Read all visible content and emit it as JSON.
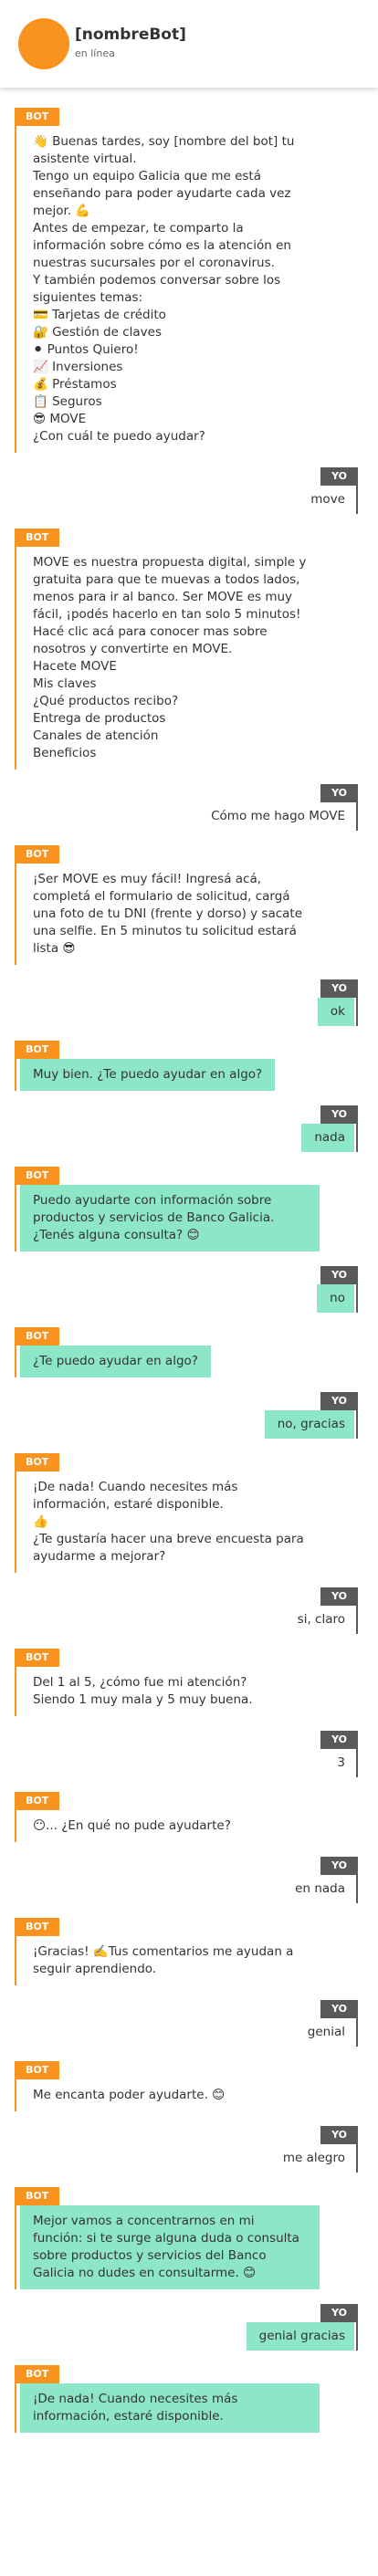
{
  "header": {
    "name": "[nombreBot]",
    "status": "en línea"
  },
  "colors": {
    "bot_accent": "#f7931e",
    "user_accent": "#5a5a5a",
    "highlight": "#8de6c7"
  },
  "labels": {
    "bot": "BOT",
    "user": "YO"
  },
  "messages": [
    {
      "from": "bot",
      "hl": false,
      "text": "👋 Buenas tardes, soy [nombre del bot] tu asistente virtual.\nTengo un equipo Galicia que me está enseñando para poder ayudarte cada vez mejor. 💪\nAntes de empezar, te comparto la información sobre cómo es la atención en nuestras sucursales por el coronavirus.\nY también podemos conversar sobre los siguientes temas:\n💳 Tarjetas de crédito\n🔐 Gestión de claves\n⚫ Puntos Quiero!\n📈 Inversiones\n💰 Préstamos\n📋 Seguros\n😎 MOVE\n¿Con cuál te puedo ayudar?"
    },
    {
      "from": "user",
      "hl": false,
      "text": "move"
    },
    {
      "from": "bot",
      "hl": false,
      "text": "MOVE es nuestra propuesta digital, simple y gratuita para que te muevas a todos lados, menos para ir al banco. Ser MOVE es muy fácil, ¡podés hacerlo en tan solo 5 minutos!\nHacé clic acá para conocer mas sobre nosotros y convertirte en MOVE.\nHacete MOVE\nMis claves\n¿Qué productos recibo?\nEntrega de productos\nCanales de atención\nBeneficios"
    },
    {
      "from": "user",
      "hl": false,
      "text": "Cómo me hago MOVE"
    },
    {
      "from": "bot",
      "hl": false,
      "text": "¡Ser MOVE es muy fácil! Ingresá acá, completá el formulario de solicitud, cargá una foto de tu DNI (frente y dorso) y sacate una selfie. En 5 minutos tu solicitud estará lista 😎"
    },
    {
      "from": "user",
      "hl": true,
      "text": "ok"
    },
    {
      "from": "bot",
      "hl": true,
      "text": "Muy bien. ¿Te puedo ayudar en algo?"
    },
    {
      "from": "user",
      "hl": true,
      "text": "nada"
    },
    {
      "from": "bot",
      "hl": true,
      "text": "Puedo ayudarte con información sobre productos y servicios de Banco Galicia. ¿Tenés alguna consulta? 😊"
    },
    {
      "from": "user",
      "hl": true,
      "text": "no"
    },
    {
      "from": "bot",
      "hl": true,
      "text": "¿Te puedo ayudar en algo?"
    },
    {
      "from": "user",
      "hl": true,
      "text": "no, gracias"
    },
    {
      "from": "bot",
      "hl": false,
      "text": "¡De nada! Cuando necesites más información, estaré disponible.\n👍\n¿Te gustaría hacer una breve encuesta para ayudarme a mejorar?"
    },
    {
      "from": "user",
      "hl": false,
      "text": "si, claro"
    },
    {
      "from": "bot",
      "hl": false,
      "text": "Del 1 al 5, ¿cómo fue mi atención?\nSiendo 1 muy mala y 5 muy buena."
    },
    {
      "from": "user",
      "hl": false,
      "text": "3"
    },
    {
      "from": "bot",
      "hl": false,
      "text": "😶... ¿En qué no pude ayudarte?"
    },
    {
      "from": "user",
      "hl": false,
      "text": "en nada"
    },
    {
      "from": "bot",
      "hl": false,
      "text": "¡Gracias! ✍️Tus comentarios me ayudan a seguir aprendiendo."
    },
    {
      "from": "user",
      "hl": false,
      "text": "genial"
    },
    {
      "from": "bot",
      "hl": false,
      "text": "Me encanta poder ayudarte. 😊"
    },
    {
      "from": "user",
      "hl": false,
      "text": "me alegro"
    },
    {
      "from": "bot",
      "hl": true,
      "text": "Mejor vamos a concentrarnos en mi función: si te surge alguna duda o consulta sobre productos y servicios del Banco Galicia no dudes en consultarme. 😊"
    },
    {
      "from": "user",
      "hl": true,
      "text": "genial gracias"
    },
    {
      "from": "bot",
      "hl": true,
      "text": "¡De nada! Cuando necesites más información, estaré disponible."
    }
  ]
}
